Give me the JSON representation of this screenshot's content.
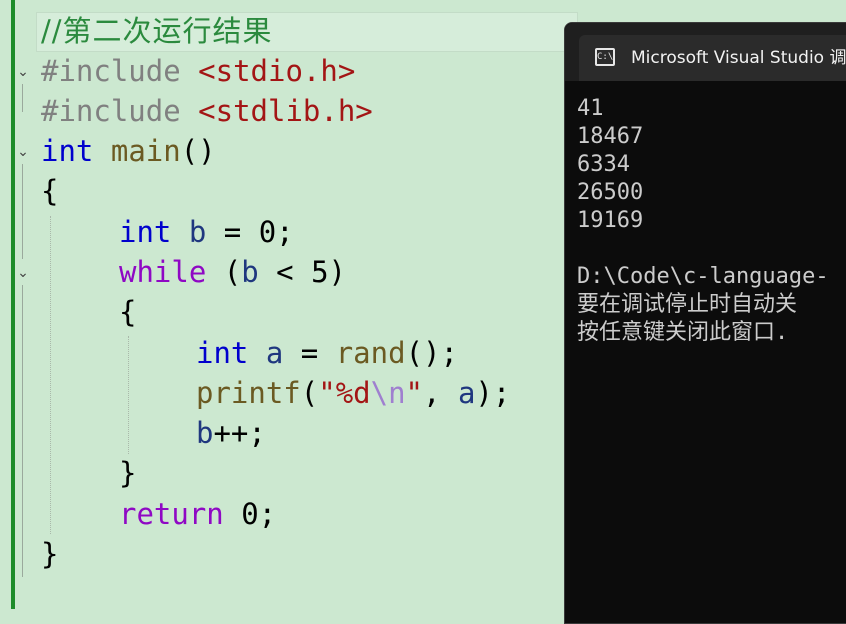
{
  "editor": {
    "comment": "//第二次运行结果",
    "lines": [
      {
        "pre": "#include",
        "hdr": "<stdio.h>"
      },
      {
        "pre": "#include",
        "hdr": "<stdlib.h>"
      }
    ],
    "main_kw": "int",
    "main_fn": "main",
    "main_paren": "()",
    "brace_open": "{",
    "decl_kw": "int",
    "decl_var": "b",
    "decl_rest": " = 0;",
    "while_kw": "while",
    "while_open": " (",
    "while_var": "b",
    "while_rest": " < 5)",
    "inner_open": "{",
    "a_kw": "int",
    "a_var": "a",
    "a_eq": " = ",
    "a_fn": "rand",
    "a_rest": "();",
    "printf_fn": "printf",
    "printf_open": "(",
    "printf_str1": "\"%d",
    "printf_esc": "\\n",
    "printf_str2": "\"",
    "printf_comma": ", ",
    "printf_var": "a",
    "printf_close": ");",
    "incr_var": "b",
    "incr_rest": "++;",
    "inner_close": "}",
    "return_kw": "return",
    "return_rest": " 0;",
    "brace_close": "}"
  },
  "console": {
    "title": "Microsoft Visual Studio 调",
    "icon": "console-app-icon",
    "output": [
      "41",
      "18467",
      "6334",
      "26500",
      "19169",
      "",
      "D:\\Code\\c-language-",
      "要在调试停止时自动关",
      "按任意键关闭此窗口."
    ]
  },
  "colors": {
    "editor_bg": "#cce8d0",
    "console_bg": "#0c0c0c",
    "keyword": "#0000cd",
    "control": "#8f08c4",
    "string": "#a31515",
    "comment": "#2b8a3e"
  }
}
